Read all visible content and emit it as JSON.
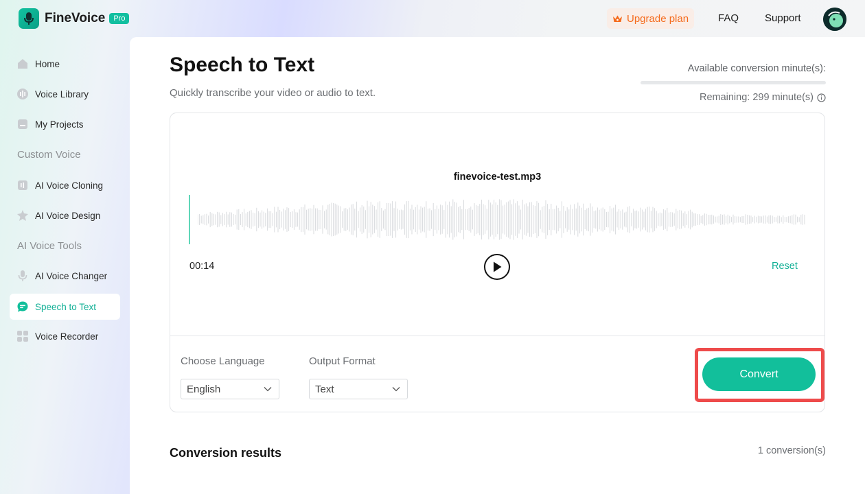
{
  "header": {
    "brand": "FineVoice",
    "badge": "Pro",
    "upgrade_label": "Upgrade plan",
    "faq_label": "FAQ",
    "support_label": "Support"
  },
  "sidebar": {
    "items": [
      {
        "label": "Home",
        "icon": "home-icon"
      },
      {
        "label": "Voice Library",
        "icon": "voice-library-icon"
      },
      {
        "label": "My Projects",
        "icon": "projects-icon"
      },
      {
        "label": "AI Voice Cloning",
        "icon": "voice-cloning-icon"
      },
      {
        "label": "AI Voice Design",
        "icon": "voice-design-icon"
      },
      {
        "label": "AI Voice Changer",
        "icon": "microphone-icon"
      },
      {
        "label": "Speech to Text",
        "icon": "chat-bubble-icon",
        "active": true
      },
      {
        "label": "Voice Recorder",
        "icon": "grid-icon"
      }
    ],
    "sections": {
      "custom_voice": "Custom Voice",
      "ai_voice_tools": "AI Voice Tools"
    }
  },
  "main": {
    "title": "Speech to Text",
    "subtitle": "Quickly transcribe your video or audio to text.",
    "minutes_label": "Available conversion minute(s):",
    "remaining": "Remaining: 299 minute(s)",
    "file_name": "finevoice-test.mp3",
    "time": "00:14",
    "reset_label": "Reset",
    "language_label": "Choose Language",
    "language_value": "English",
    "format_label": "Output Format",
    "format_value": "Text",
    "convert_label": "Convert",
    "results_title": "Conversion results",
    "results_count": "1 conversion(s)"
  },
  "colors": {
    "accent": "#12bf9b",
    "highlight_frame": "#ee4b4b",
    "upgrade": "#f56a1b"
  }
}
